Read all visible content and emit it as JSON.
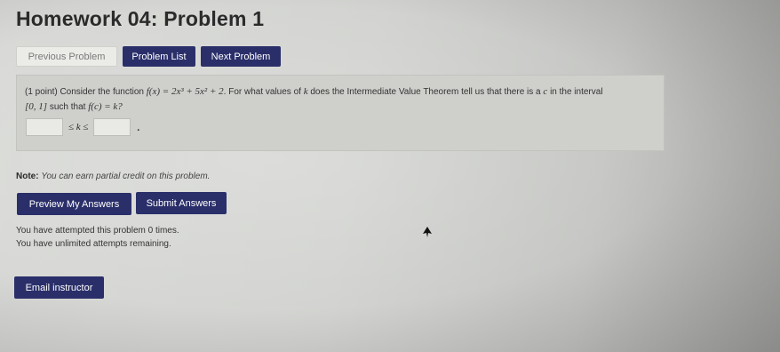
{
  "page": {
    "title": "Homework 04: Problem 1"
  },
  "nav": {
    "previous_label": "Previous Problem",
    "list_label": "Problem List",
    "next_label": "Next Problem"
  },
  "problem": {
    "intro": "(1 point) Consider the function",
    "function_expr": "f(x) = 2x³ + 5x² + 2",
    "question_mid": ". For what values of",
    "variable_k": "k",
    "question_end": "does the Intermediate Value Theorem tell us that there is a",
    "variable_c": "c",
    "in_interval": "in the interval",
    "interval": "[0, 1]",
    "such_that": "such that",
    "condition": "f(c) = k?",
    "inequality_middle": "≤ k ≤",
    "period": ".",
    "lower_bound_value": "",
    "upper_bound_value": ""
  },
  "note": {
    "label": "Note:",
    "text": "You can earn partial credit on this problem."
  },
  "actions": {
    "preview_label": "Preview My Answers",
    "submit_label": "Submit Answers"
  },
  "status": {
    "attempted": "You have attempted this problem 0 times.",
    "remaining": "You have unlimited attempts remaining."
  },
  "email": {
    "label": "Email instructor"
  }
}
